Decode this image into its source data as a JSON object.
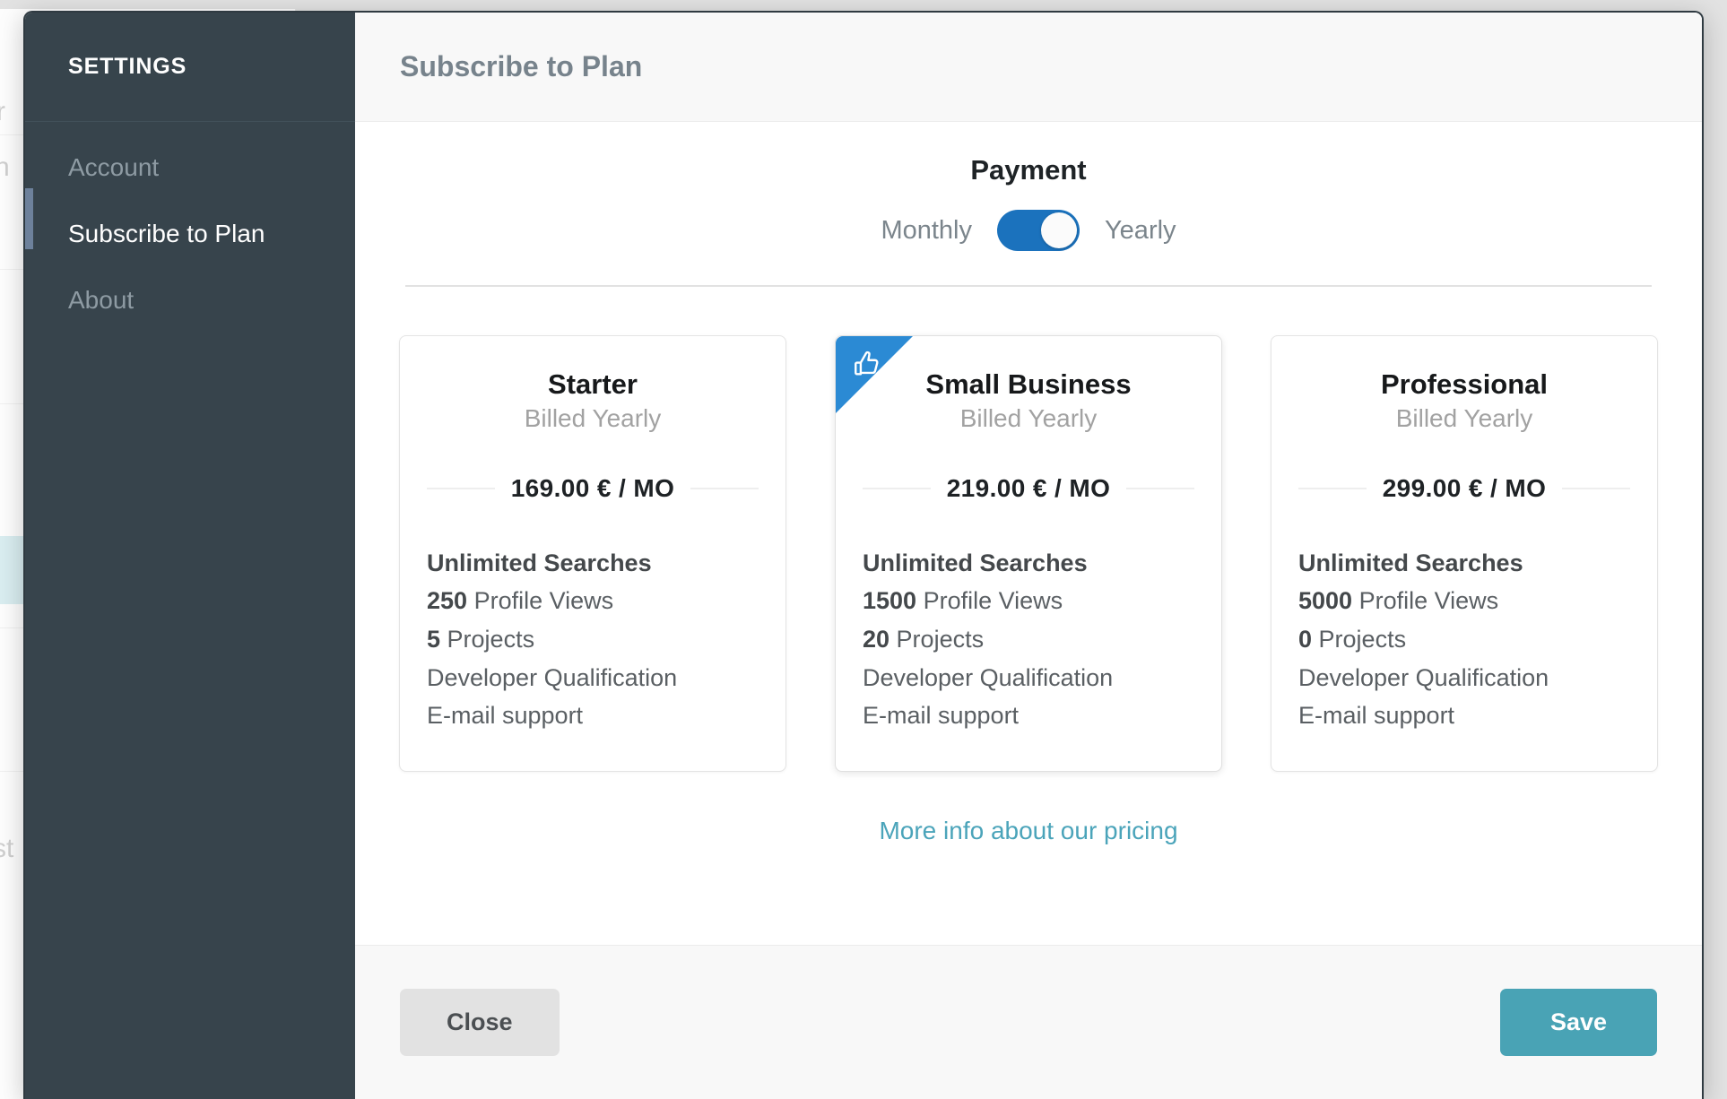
{
  "sidebar": {
    "title": "SETTINGS",
    "items": [
      {
        "label": "Account",
        "active": false
      },
      {
        "label": "Subscribe to Plan",
        "active": true
      },
      {
        "label": "About",
        "active": false
      }
    ]
  },
  "header": {
    "title": "Subscribe to Plan"
  },
  "payment": {
    "heading": "Payment",
    "left_label": "Monthly",
    "right_label": "Yearly",
    "selected": "Yearly",
    "toggle_on_color": "#1b72bd"
  },
  "plans": [
    {
      "name": "Starter",
      "billing": "Billed Yearly",
      "price": "169.00 € / MO",
      "featured": false,
      "badge_icon": "",
      "features": [
        {
          "strong": "",
          "text": "Unlimited Searches",
          "all_bold": true
        },
        {
          "strong": "250",
          "text": " Profile Views",
          "all_bold": false
        },
        {
          "strong": "5",
          "text": " Projects",
          "all_bold": false
        },
        {
          "strong": "",
          "text": "Developer Qualification",
          "all_bold": false
        },
        {
          "strong": "",
          "text": "E-mail support",
          "all_bold": false
        }
      ]
    },
    {
      "name": "Small Business",
      "billing": "Billed Yearly",
      "price": "219.00 € / MO",
      "featured": true,
      "badge_icon": "thumbs-up-icon",
      "features": [
        {
          "strong": "",
          "text": "Unlimited Searches",
          "all_bold": true
        },
        {
          "strong": "1500",
          "text": " Profile Views",
          "all_bold": false
        },
        {
          "strong": "20",
          "text": " Projects",
          "all_bold": false
        },
        {
          "strong": "",
          "text": "Developer Qualification",
          "all_bold": false
        },
        {
          "strong": "",
          "text": "E-mail support",
          "all_bold": false
        }
      ]
    },
    {
      "name": "Professional",
      "billing": "Billed Yearly",
      "price": "299.00 € / MO",
      "featured": false,
      "badge_icon": "",
      "features": [
        {
          "strong": "",
          "text": "Unlimited Searches",
          "all_bold": true
        },
        {
          "strong": "5000",
          "text": " Profile Views",
          "all_bold": false
        },
        {
          "strong": "0",
          "text": " Projects",
          "all_bold": false
        },
        {
          "strong": "",
          "text": "Developer Qualification",
          "all_bold": false
        },
        {
          "strong": "",
          "text": "E-mail support",
          "all_bold": false
        }
      ]
    }
  ],
  "pricing_link": {
    "label": "More info about our pricing",
    "color": "#4ba4ba"
  },
  "footer": {
    "close_label": "Close",
    "save_label": "Save",
    "save_color": "#49a3b5"
  },
  "background": {
    "ghost_texts": [
      "r",
      "n",
      "st"
    ]
  }
}
